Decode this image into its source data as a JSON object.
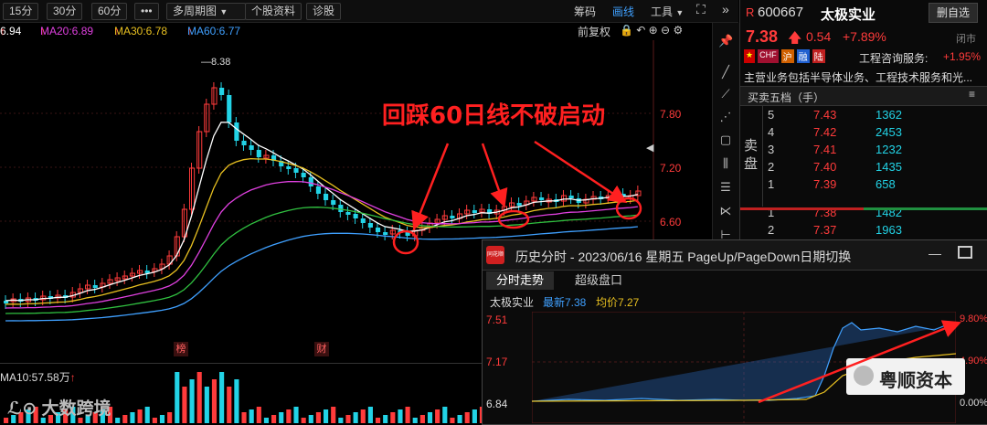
{
  "toolbar": {
    "buttons": [
      "15分",
      "30分",
      "60分",
      "•••",
      "多周期图",
      "个股资料",
      "诊股"
    ],
    "dropdown_arrow": "▼",
    "right_items": [
      "筹码",
      "画线",
      "工具"
    ],
    "active_item": "画线"
  },
  "ma_bar": {
    "ma10": "6.94",
    "ma20": "MA20:6.89",
    "ma30": "MA30:6.78",
    "ma60": "MA60:6.77",
    "up_arrow": "↑",
    "fq": "前复权"
  },
  "chart": {
    "high_label": "8.38",
    "price_ticks": [
      "7.80",
      "7.20",
      "6.60"
    ],
    "annotation": "回踩60日线不破启动",
    "bottom_tags": [
      "榜",
      "财"
    ],
    "volume_label": "MA10:57.58万",
    "watermark": "大数跨境"
  },
  "chart_data": {
    "type": "candlestick",
    "y_ticks": [
      7.8,
      7.2,
      6.6
    ],
    "high_marker": 8.38,
    "ma_values": {
      "MA10": 6.94,
      "MA20": 6.89,
      "MA30": 6.78,
      "MA60": 6.77
    }
  },
  "stock": {
    "code": "600667",
    "name": "太极实业",
    "flag": "R",
    "remove_btn": "删自选",
    "price": "7.38",
    "change": "0.54",
    "pct": "+7.89%",
    "status": "闭市",
    "badges": [
      "🇨🇳",
      "CHF",
      "沪",
      "融",
      "陆"
    ],
    "sector": "工程咨询服务:",
    "sector_pct": "+1.95%",
    "desc": "主营业务包括半导体业务、工程技术服务和光...",
    "book_title": "买卖五档（手）",
    "sell_label": "卖盘",
    "sells": [
      {
        "lvl": "5",
        "price": "7.43",
        "vol": "1362"
      },
      {
        "lvl": "4",
        "price": "7.42",
        "vol": "2453"
      },
      {
        "lvl": "3",
        "price": "7.41",
        "vol": "1232"
      },
      {
        "lvl": "2",
        "price": "7.40",
        "vol": "1435"
      },
      {
        "lvl": "1",
        "price": "7.39",
        "vol": "658"
      }
    ],
    "buys": [
      {
        "lvl": "1",
        "price": "7.38",
        "vol": "1482"
      },
      {
        "lvl": "2",
        "price": "7.37",
        "vol": "1963"
      }
    ]
  },
  "popup": {
    "logo": "同花顺",
    "title": "历史分时 - 2023/06/16 星期五 PageUp/PageDown日期切换",
    "tabs": [
      "分时走势",
      "超级盘口"
    ],
    "name": "太极实业",
    "latest": "最新7.38",
    "avg": "均价7.27",
    "y_left": [
      "7.51",
      "7.17",
      "6.84"
    ],
    "y_right": [
      "9.80%",
      "4.90%",
      "0.00%"
    ],
    "wechat": "粤顺资本"
  },
  "colors": {
    "up": "#ff3b3b",
    "down": "#22d3e6",
    "ma10": "#ffffff",
    "ma20": "#e040e0",
    "ma30": "#e8c020",
    "ma60": "#3fa0ff",
    "ma_green": "#30c040"
  }
}
